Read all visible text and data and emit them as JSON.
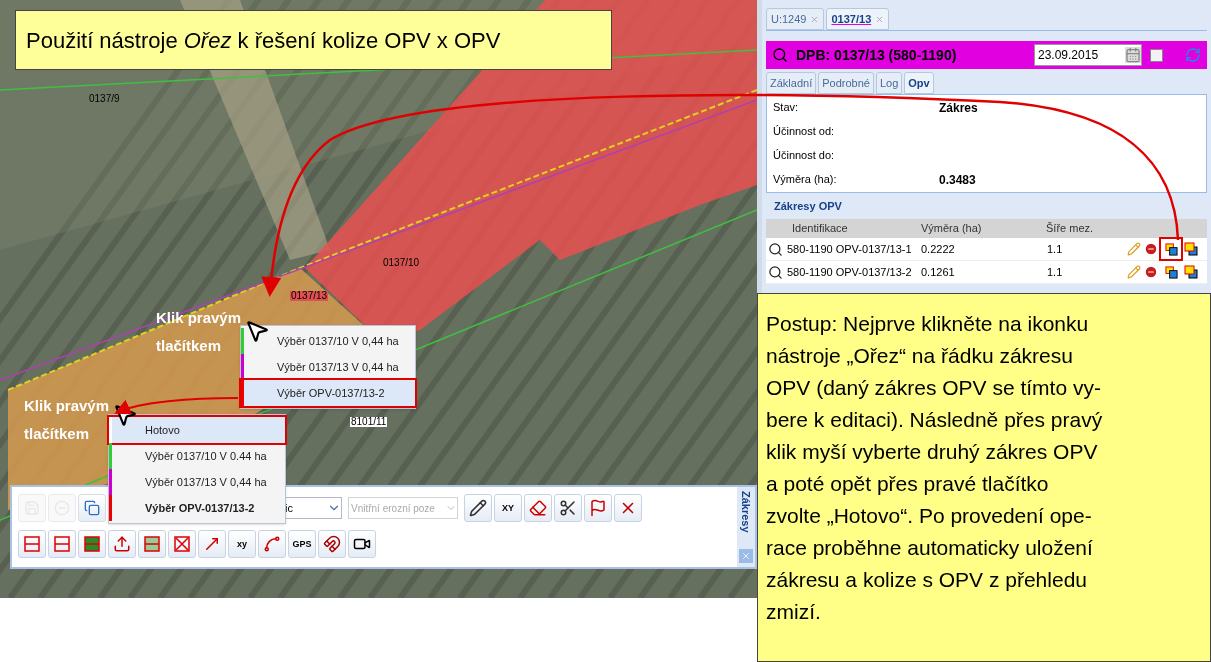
{
  "title_callout": "Použití nástroje *Ořez* k řešení kolize OPV x OPV",
  "map": {
    "labels": [
      {
        "text": "0137/9"
      },
      {
        "text": "0137/10"
      },
      {
        "text": "0137/13"
      },
      {
        "text": "8101/11"
      }
    ]
  },
  "annotations": [
    "Klik pravým tlačítkem",
    "Klik pravým tlačítkem"
  ],
  "context_menus": [
    {
      "items": [
        {
          "label": "Výběr 0137/10 V 0,44 ha",
          "selected": false,
          "marked": false,
          "bold": false,
          "color": "#33cc33"
        },
        {
          "label": "Výběr 0137/13 V 0,44 ha",
          "selected": false,
          "marked": false,
          "bold": false,
          "color": "#cc00cc"
        },
        {
          "label": "Výběr OPV-0137/13-2",
          "selected": true,
          "marked": true,
          "bold": false,
          "color": "#ee0000"
        }
      ]
    },
    {
      "items": [
        {
          "label": "Hotovo",
          "selected": true,
          "marked": true,
          "bold": false,
          "color": "#ffffff"
        },
        {
          "label": "Výběr 0137/10 V 0.44 ha",
          "selected": false,
          "marked": false,
          "bold": false,
          "color": "#33cc33"
        },
        {
          "label": "Výběr 0137/13 V 0,44 ha",
          "selected": false,
          "marked": false,
          "bold": false,
          "color": "#cc00cc"
        },
        {
          "label": "Výběr OPV-0137/13-2",
          "selected": false,
          "marked": false,
          "bold": true,
          "color": "#ee0000"
        }
      ]
    }
  ],
  "toolbar": {
    "row1_start": [
      {
        "kind": "save",
        "disabled": true
      },
      {
        "kind": "delete",
        "disabled": true
      },
      {
        "kind": "windows",
        "disabled": false
      }
    ],
    "combo_value": "ic",
    "combo_placeholder": "Vnitřní erozní poze",
    "row1_tools": [
      {
        "kind": "pen"
      },
      {
        "kind": "xy",
        "text": "XY"
      },
      {
        "kind": "eraser"
      },
      {
        "kind": "scissors"
      },
      {
        "kind": "scissors-flag"
      },
      {
        "kind": "cross"
      }
    ],
    "row2_tools": [
      {
        "kind": "shape-cut"
      },
      {
        "kind": "shape-s"
      },
      {
        "kind": "shape-fill"
      },
      {
        "kind": "upload"
      },
      {
        "kind": "shape-hatch"
      },
      {
        "kind": "shape-x"
      },
      {
        "kind": "arrow"
      },
      {
        "kind": "xy",
        "text": "xy"
      },
      {
        "kind": "nodes"
      },
      {
        "kind": "gps",
        "text": "GPS"
      },
      {
        "kind": "magnet"
      },
      {
        "kind": "camera"
      }
    ],
    "side_tab": "Zákresy"
  },
  "panel": {
    "tabs": [
      {
        "label": "U:1249",
        "selected": false
      },
      {
        "label": "0137/13",
        "selected": true
      }
    ],
    "header": {
      "title": "DPB: 0137/13 (580-1190)",
      "date": "23.09.2015",
      "checked": false
    },
    "subtabs": [
      {
        "label": "Základní",
        "selected": false
      },
      {
        "label": "Podrobné",
        "selected": false
      },
      {
        "label": "Log",
        "selected": false
      },
      {
        "label": "Opv",
        "selected": true
      }
    ],
    "fields": [
      {
        "label": "Stav:",
        "value": "Zákres"
      },
      {
        "label": "Účinnost od:"
      },
      {
        "label": "Účinnost do:"
      },
      {
        "label": "Výměra (ha):",
        "value": "0.3483"
      }
    ],
    "section": "Zákresy OPV",
    "table": {
      "columns": [
        "Identifikace",
        "Výměra (ha)",
        "Šíře mez."
      ],
      "rows": [
        {
          "cells": [
            "580-1190 OPV-0137/13-1",
            "0.2222",
            "1.1"
          ],
          "cut_marked": true
        },
        {
          "cells": [
            "580-1190 OPV-0137/13-2",
            "0.1261",
            "1.1"
          ],
          "cut_marked": false
        }
      ]
    }
  },
  "callout": "Postup: Nejprve klikněte na ikonku\nnástroje „Ořez“ na řádku zákresu\nOPV (daný zákres OPV se tímto vy-\nbere k editaci). Následně přes pravý\nklik myší vyberte druhý zákres OPV\na poté opět přes pravé tlačítko\nzvolte „Hotovo“. Po provedení ope-\nrace proběhne automaticky uložení\nzákresu a kolize s OPV z přehledu\nzmizí."
}
